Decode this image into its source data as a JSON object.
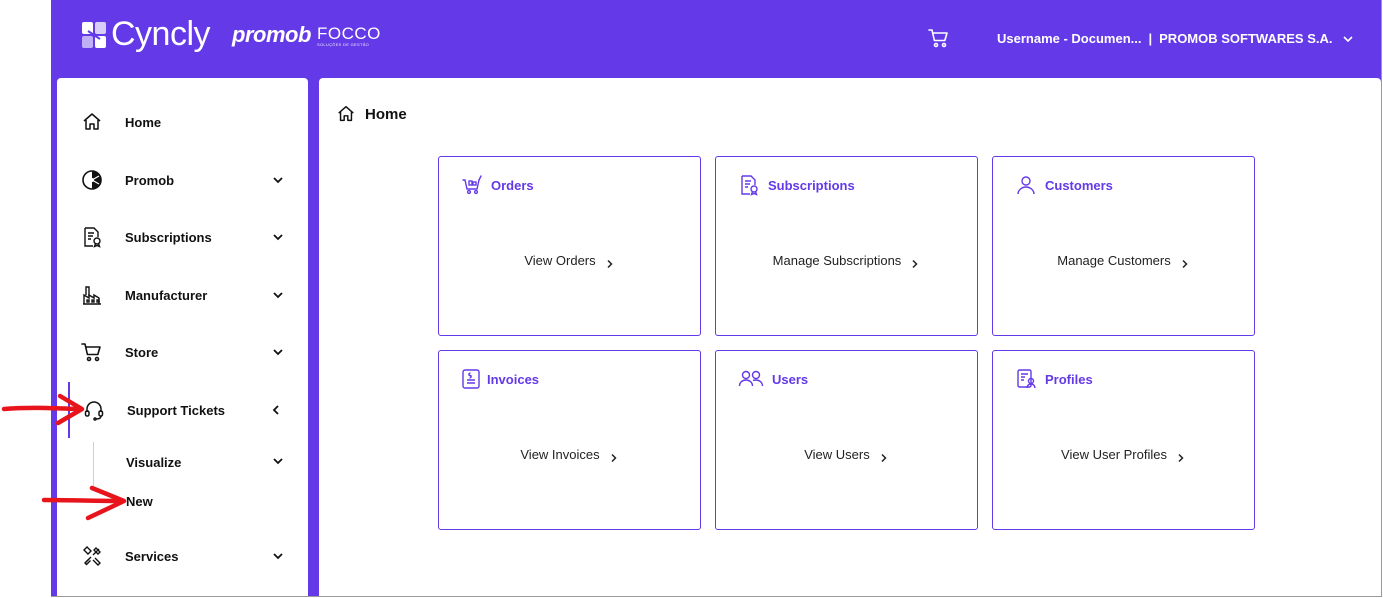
{
  "header": {
    "brand": "Cyncly",
    "partner1": "promob",
    "partner2": "FOCCO",
    "partner2_tagline": "SOLUÇÕES DE GESTÃO",
    "cart_icon": "cart-icon",
    "user": "Username - Documen...",
    "separator": "|",
    "company": "PROMOB SOFTWARES S.A."
  },
  "sidebar": {
    "items": [
      {
        "label": "Home",
        "icon": "home-icon"
      },
      {
        "label": "Promob",
        "icon": "promob-icon"
      },
      {
        "label": "Subscriptions",
        "icon": "subscriptions-icon"
      },
      {
        "label": "Manufacturer",
        "icon": "factory-icon"
      },
      {
        "label": "Store",
        "icon": "cart-icon"
      },
      {
        "label": "Support Tickets",
        "icon": "headset-icon"
      },
      {
        "label": "Services",
        "icon": "tools-icon"
      }
    ],
    "sub_items": [
      {
        "label": "Visualize"
      },
      {
        "label": "New"
      }
    ]
  },
  "main": {
    "title": "Home",
    "cards": [
      {
        "title": "Orders",
        "action": "View Orders",
        "icon": "orders-icon"
      },
      {
        "title": "Subscriptions",
        "action": "Manage Subscriptions",
        "icon": "subscriptions-icon"
      },
      {
        "title": "Customers",
        "action": "Manage Customers",
        "icon": "customer-icon"
      },
      {
        "title": "Invoices",
        "action": "View Invoices",
        "icon": "invoice-icon"
      },
      {
        "title": "Users",
        "action": "View Users",
        "icon": "users-icon"
      },
      {
        "title": "Profiles",
        "action": "View User Profiles",
        "icon": "profiles-icon"
      }
    ]
  },
  "colors": {
    "brand": "#6439e8",
    "annotation": "#e8141b"
  }
}
